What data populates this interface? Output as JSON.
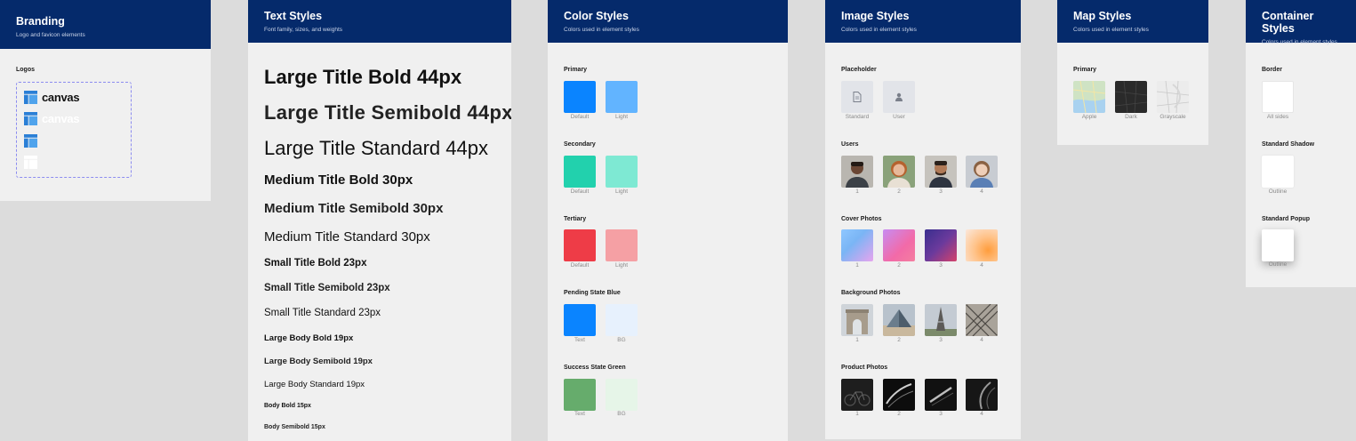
{
  "branding": {
    "title": "Branding",
    "subtitle": "Logo and favicon elements",
    "logos_label": "Logos",
    "logo_word_dark": "canvas",
    "logo_word_light": "canvas"
  },
  "text_styles": {
    "title": "Text Styles",
    "subtitle": "Font family, sizes, and weights",
    "samples": [
      "Large Title Bold 44px",
      "Large Title Semibold 44px",
      "Large Title Standard 44px",
      "Medium Title Bold 30px",
      "Medium Title Semibold 30px",
      "Medium Title Standard 30px",
      "Small Title Bold 23px",
      "Small Title Semibold 23px",
      "Small Title Standard 23px",
      "Large Body Bold 19px",
      "Large Body Semibold 19px",
      "Large Body Standard 19px",
      "Body Bold 15px",
      "Body Semibold 15px"
    ]
  },
  "color_styles": {
    "title": "Color Styles",
    "subtitle": "Colors used in element styles",
    "groups": [
      {
        "label": "Primary",
        "swatches": [
          {
            "caption": "Default",
            "color": "#0a84ff"
          },
          {
            "caption": "Light",
            "color": "#62b4ff"
          }
        ]
      },
      {
        "label": "Secondary",
        "swatches": [
          {
            "caption": "Default",
            "color": "#22d1ad"
          },
          {
            "caption": "Light",
            "color": "#7ee9d3"
          }
        ]
      },
      {
        "label": "Tertiary",
        "swatches": [
          {
            "caption": "Default",
            "color": "#ee3c47"
          },
          {
            "caption": "Light",
            "color": "#f5a0a4"
          }
        ]
      },
      {
        "label": "Pending State Blue",
        "swatches": [
          {
            "caption": "Text",
            "color": "#0a84ff"
          },
          {
            "caption": "BG",
            "color": "#e7f1fd"
          }
        ]
      },
      {
        "label": "Success State Green",
        "swatches": [
          {
            "caption": "Text",
            "color": "#66ac6c"
          },
          {
            "caption": "BG",
            "color": "#e6f5e8"
          }
        ]
      }
    ]
  },
  "image_styles": {
    "title": "Image Styles",
    "subtitle": "Colors used in element styles",
    "placeholder_label": "Placeholder",
    "placeholder_captions": [
      "Standard",
      "User"
    ],
    "users_label": "Users",
    "cover_label": "Cover Photos",
    "background_label": "Background Photos",
    "product_label": "Product Photos",
    "numbers": [
      "1",
      "2",
      "3",
      "4"
    ]
  },
  "map_styles": {
    "title": "Map Styles",
    "subtitle": "Colors used in element styles",
    "primary_label": "Primary",
    "captions": [
      "Apple",
      "Dark",
      "Grayscale"
    ]
  },
  "container_styles": {
    "title": "Container Styles",
    "subtitle": "Colors used in element styles",
    "border_label": "Border",
    "border_caption": "All sides",
    "shadow_label": "Standard Shadow",
    "shadow_caption": "Outline",
    "popup_label": "Standard Popup",
    "popup_caption": "Outline"
  }
}
